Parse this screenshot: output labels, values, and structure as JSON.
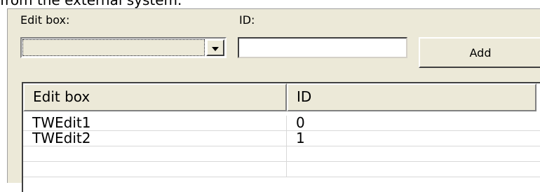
{
  "top_text": "from the external system.",
  "form": {
    "editbox_label": "Edit box:",
    "editbox_value": "",
    "id_label": "ID:",
    "id_value": "",
    "add_label": "Add"
  },
  "table": {
    "columns": [
      "Edit box",
      "ID"
    ],
    "rows": [
      [
        "TWEdit1",
        "0"
      ],
      [
        "TWEdit2",
        "1"
      ],
      [
        "",
        ""
      ],
      [
        "",
        ""
      ]
    ]
  }
}
